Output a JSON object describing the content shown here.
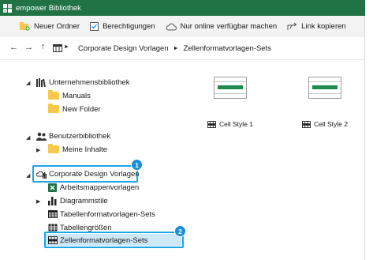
{
  "window": {
    "title": "empower Bibliothek",
    "accent": "#217346"
  },
  "toolbar": {
    "new_folder": "Neuer Ordner",
    "permissions": "Berechtigungen",
    "online_only": "Nur online verfügbar machen",
    "copy_link": "Link kopieren"
  },
  "address": {
    "back": "←",
    "forward": "→",
    "up": "↑",
    "path": [
      "Corporate Design Vorlagen",
      "Zellenformatvorlagen-Sets"
    ]
  },
  "tree": {
    "company_lib": "Unternehmensbibliothek",
    "manuals": "Manuals",
    "new_folder": "New Folder",
    "user_lib": "Benutzerbibliothek",
    "my_content": "Meine Inhalte",
    "cd_templates": "Corporate Design Vorlagen",
    "workbook_templates": "Arbeitsmappenvorlagen",
    "chart_styles": "Diagrammstile",
    "table_style_sets": "Tabellenformatvorlagen-Sets",
    "table_sizes": "Tabellengrößen",
    "cell_style_sets": "Zellenformatvorlagen-Sets"
  },
  "callouts": {
    "one": "1",
    "two": "2",
    "color": "#1a8fd8"
  },
  "content": {
    "items": [
      {
        "label": "Cell Style 1"
      },
      {
        "label": "Cell Style 2"
      }
    ]
  }
}
